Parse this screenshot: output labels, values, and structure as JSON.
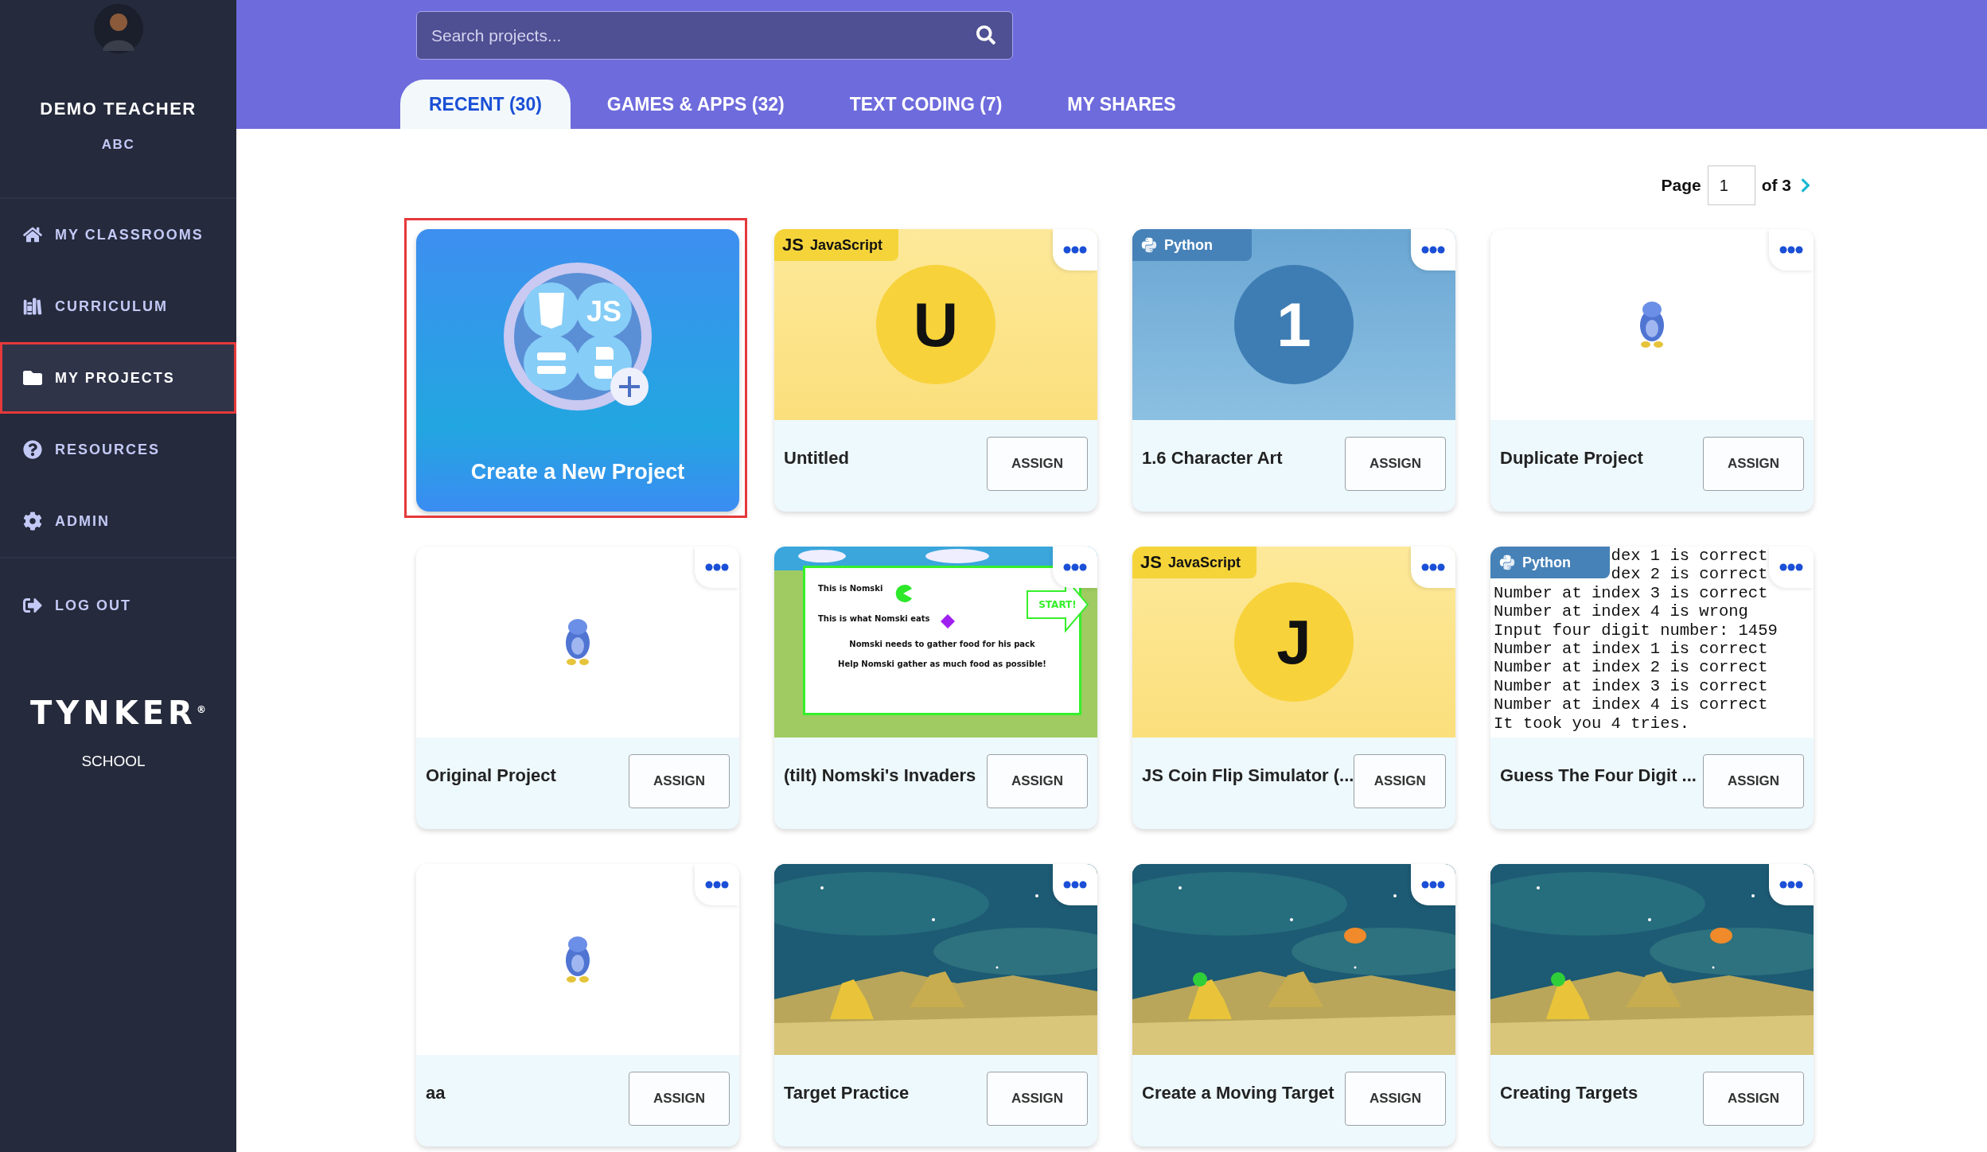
{
  "sidebar": {
    "user": {
      "name": "DEMO TEACHER",
      "org": "ABC"
    },
    "nav": [
      {
        "label": "MY CLASSROOMS",
        "selected": false,
        "highlighted": false
      },
      {
        "label": "CURRICULUM",
        "selected": false,
        "highlighted": false
      },
      {
        "label": "MY PROJECTS",
        "selected": true,
        "highlighted": true
      },
      {
        "label": "RESOURCES",
        "selected": false,
        "highlighted": false
      },
      {
        "label": "ADMIN",
        "selected": false,
        "highlighted": false
      }
    ],
    "logout": {
      "label": "LOG OUT"
    },
    "brand": {
      "logo": "TYNKER",
      "mark": "®",
      "subtitle": "SCHOOL"
    }
  },
  "header": {
    "search": {
      "placeholder": "Search projects..."
    },
    "tabs": [
      {
        "label": "RECENT (30)",
        "selected": true
      },
      {
        "label": "GAMES & APPS (32)",
        "selected": false
      },
      {
        "label": "TEXT CODING (7)",
        "selected": false
      },
      {
        "label": "MY SHARES",
        "selected": false
      }
    ]
  },
  "pagination": {
    "label": "Page",
    "value": "1",
    "total": "of 3"
  },
  "cards": [
    {
      "kind": "new",
      "title": "Create a New Project",
      "icon_label": "JS",
      "highlighted": true
    },
    {
      "kind": "project",
      "title": "Untitled",
      "button": "ASSIGN",
      "thumb": {
        "kind": "letter",
        "badge": {
          "kind": "js",
          "logo": "JS",
          "label": "JavaScript"
        },
        "text": "U"
      }
    },
    {
      "kind": "project",
      "title": "1.6 Character Art",
      "button": "ASSIGN",
      "thumb": {
        "kind": "letter",
        "badge": {
          "kind": "python",
          "label": "Python"
        },
        "text": "1"
      }
    },
    {
      "kind": "project",
      "title": "Duplicate Project",
      "button": "ASSIGN",
      "thumb": {
        "kind": "sprite"
      }
    },
    {
      "kind": "project",
      "title": "Original Project",
      "button": "ASSIGN",
      "thumb": {
        "kind": "sprite"
      }
    },
    {
      "kind": "project",
      "title": "(tilt) Nomski's Invaders",
      "button": "ASSIGN",
      "thumb": {
        "kind": "game",
        "lines": [
          "This is Nomski",
          "This is what Nomski eats",
          "Nomski needs to gather food for his pack",
          "Help Nomski gather as much food as possible!"
        ],
        "start": "START!"
      }
    },
    {
      "kind": "project",
      "title": "JS Coin Flip Simulator (...",
      "button": "ASSIGN",
      "thumb": {
        "kind": "letter",
        "badge": {
          "kind": "js",
          "logo": "JS",
          "label": "JavaScript"
        },
        "text": "J"
      }
    },
    {
      "kind": "project",
      "title": "Guess The Four Digit ...",
      "button": "ASSIGN",
      "thumb": {
        "kind": "console",
        "badge": {
          "kind": "python",
          "label": "Python"
        },
        "lines": [
          "            dex 1 is correct",
          "            dex 2 is correct",
          "Number at index 3 is correct",
          "Number at index 4 is wrong",
          "Input four digit number: 1459",
          "Number at index 1 is correct",
          "Number at index 2 is correct",
          "Number at index 3 is correct",
          "Number at index 4 is correct",
          "It took you 4 tries."
        ]
      }
    },
    {
      "kind": "project",
      "title": "aa",
      "button": "ASSIGN",
      "thumb": {
        "kind": "sprite"
      }
    },
    {
      "kind": "project",
      "title": "Target Practice",
      "button": "ASSIGN"
    },
    {
      "kind": "project",
      "title": "Create a Moving Target",
      "button": "ASSIGN"
    },
    {
      "kind": "project",
      "title": "Creating Targets",
      "button": "ASSIGN"
    }
  ]
}
